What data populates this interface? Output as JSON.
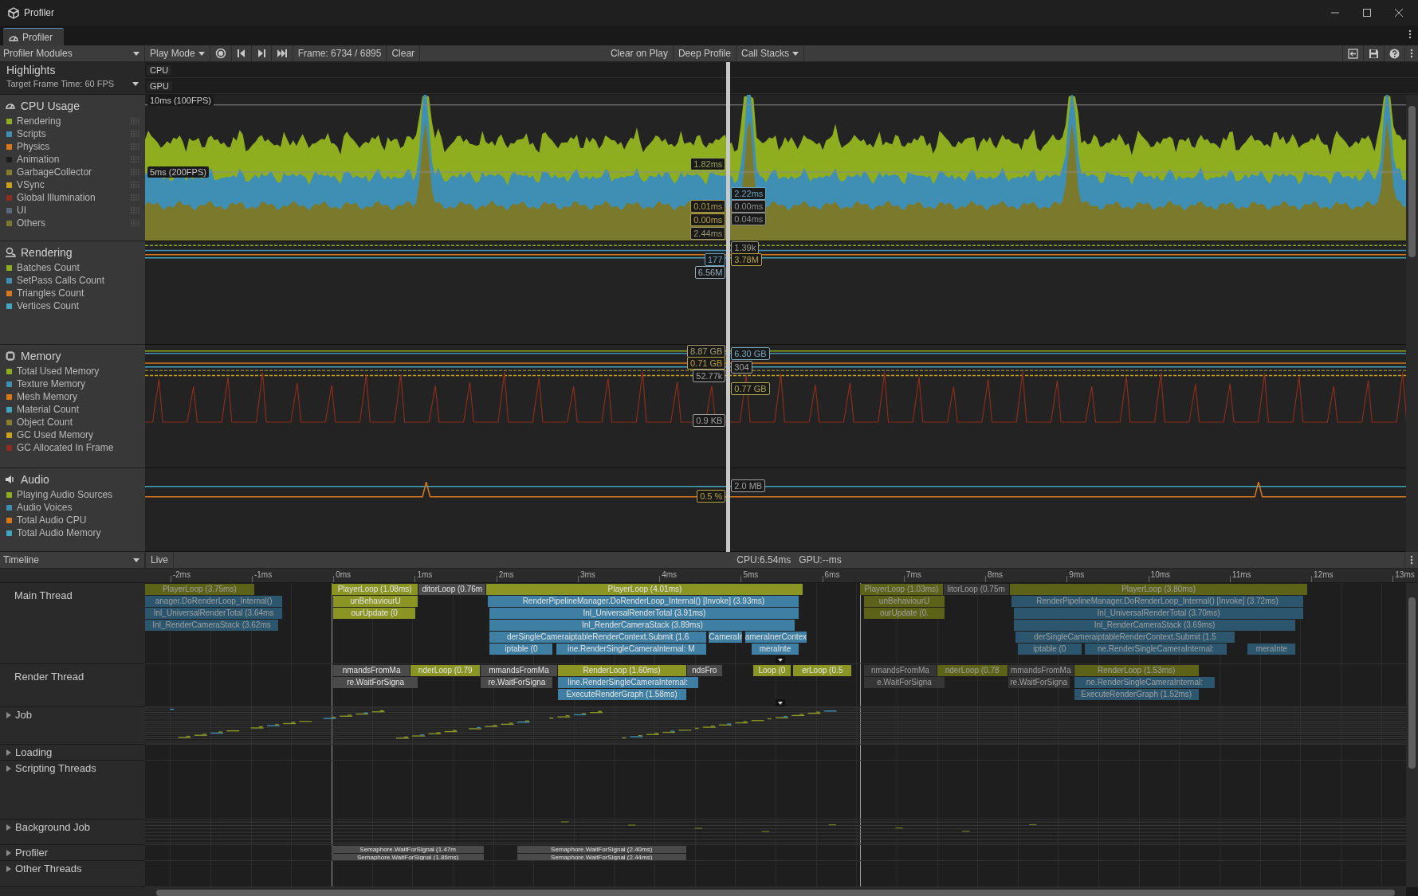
{
  "window": {
    "title": "Profiler"
  },
  "tabs": [
    {
      "label": "Profiler",
      "selected": true
    }
  ],
  "toolbar": {
    "modules_dropdown": "Profiler Modules",
    "play_mode": "Play Mode",
    "record": {
      "on": false
    },
    "frame": "Frame: 6734 / 6895",
    "clear": "Clear",
    "toggles": [
      {
        "label": "Clear on Play",
        "on": false
      },
      {
        "label": "Deep Profile",
        "on": false
      }
    ],
    "call_stacks": "Call Stacks"
  },
  "highlights": {
    "title": "Highlights",
    "target": "Target Frame Time: 60 FPS",
    "lanes": [
      "CPU",
      "GPU"
    ]
  },
  "modules": [
    {
      "name": "CPU Usage",
      "kind": "cpu",
      "grid_labels": [
        "10ms (100FPS)",
        "5ms (200FPS)"
      ],
      "legend": [
        {
          "label": "Rendering",
          "color": "#8fae1f"
        },
        {
          "label": "Scripts",
          "color": "#3f8fb5"
        },
        {
          "label": "Physics",
          "color": "#d7781c"
        },
        {
          "label": "Animation",
          "color": "#1b1b1b"
        },
        {
          "label": "GarbageCollector",
          "color": "#857c2c"
        },
        {
          "label": "VSync",
          "color": "#c9a11a"
        },
        {
          "label": "Global Illumination",
          "color": "#8c2d1d"
        },
        {
          "label": "UI",
          "color": "#586878"
        },
        {
          "label": "Others",
          "color": "#7b7a2c"
        }
      ],
      "readouts": [
        {
          "text": "1.82ms",
          "color": "#9aa84a"
        },
        {
          "text": "0.01ms",
          "color": "#a89a4a"
        },
        {
          "text": "0.00ms",
          "color": "#b8a040"
        },
        {
          "text": "2.44ms",
          "color": "#9a9670"
        },
        {
          "text": "2.22ms",
          "color": "#6aa3c0"
        },
        {
          "text": "0.00ms",
          "color": "#8e8e8e"
        },
        {
          "text": "0.04ms",
          "color": "#8e8e8e"
        }
      ]
    },
    {
      "name": "Rendering",
      "kind": "rendering",
      "legend": [
        {
          "label": "Batches Count",
          "color": "#8fae1f"
        },
        {
          "label": "SetPass Calls Count",
          "color": "#3f8fb5"
        },
        {
          "label": "Triangles Count",
          "color": "#d7781c"
        },
        {
          "label": "Vertices Count",
          "color": "#43a6c0"
        }
      ],
      "readouts": [
        {
          "text": "1.39k",
          "color": "#9a9a8a"
        },
        {
          "text": "177",
          "color": "#6aa3c0"
        },
        {
          "text": "3.78M",
          "color": "#b8a040"
        },
        {
          "text": "6.56M",
          "color": "#9ab0c0"
        }
      ]
    },
    {
      "name": "Memory",
      "kind": "memory",
      "legend": [
        {
          "label": "Total Used Memory",
          "color": "#8fae1f"
        },
        {
          "label": "Texture Memory",
          "color": "#3f8fb5"
        },
        {
          "label": "Mesh Memory",
          "color": "#d7781c"
        },
        {
          "label": "Material Count",
          "color": "#43a6c0"
        },
        {
          "label": "Object Count",
          "color": "#857c2c"
        },
        {
          "label": "GC Used Memory",
          "color": "#c9a11a"
        },
        {
          "label": "GC Allocated In Frame",
          "color": "#8c2d1d"
        }
      ],
      "readouts": [
        {
          "text": "8.87 GB",
          "color": "#a8a070"
        },
        {
          "text": "6.30 GB",
          "color": "#7aa8c0"
        },
        {
          "text": "0.71 GB",
          "color": "#b8a040"
        },
        {
          "text": "304",
          "color": "#a0a0a0"
        },
        {
          "text": "52.77k",
          "color": "#a0a0a0"
        },
        {
          "text": "0.77 GB",
          "color": "#b0a850"
        },
        {
          "text": "0.9 KB",
          "color": "#a0a0a0"
        }
      ]
    },
    {
      "name": "Audio",
      "kind": "audio",
      "legend": [
        {
          "label": "Playing Audio Sources",
          "color": "#8fae1f"
        },
        {
          "label": "Audio Voices",
          "color": "#3f8fb5"
        },
        {
          "label": "Total Audio CPU",
          "color": "#d7781c"
        },
        {
          "label": "Total Audio Memory",
          "color": "#43a6c0"
        }
      ],
      "readouts": [
        {
          "text": "2.0 MB",
          "color": "#a0a0a0"
        },
        {
          "text": "0.5 %",
          "color": "#b8a040"
        }
      ]
    }
  ],
  "timeline": {
    "view": "Timeline",
    "live": "Live",
    "cpu": "CPU:6.54ms",
    "gpu": "GPU:--ms",
    "ticks": [
      "-2ms",
      "-1ms",
      "0ms",
      "1ms",
      "2ms",
      "3ms",
      "4ms",
      "5ms",
      "6ms",
      "7ms",
      "8ms",
      "9ms",
      "10ms",
      "11ms",
      "12ms",
      "13ms"
    ],
    "threads": [
      {
        "name": "Main Thread",
        "blocks": [
          {
            "label": "PlayerLoop (3.75ms)",
            "color": "#5c6319",
            "dimmed": true
          },
          {
            "label": "PlayerLoop (1.08ms)",
            "color": "#8a9524",
            "dimmed": false
          },
          {
            "label": "ditorLoop (0.76m",
            "color": "#4a4a4a",
            "dimmed": false
          },
          {
            "label": "PlayerLoop (4.01ms)",
            "color": "#8a9524",
            "dimmed": false
          },
          {
            "label": "PlayerLoop (1.03ms)",
            "color": "#5c6319",
            "dimmed": true
          },
          {
            "label": "litorLoop (0.75m",
            "color": "#353535",
            "dimmed": true
          },
          {
            "label": "PlayerLoop (3.80ms)",
            "color": "#5c6319",
            "dimmed": true
          },
          {
            "label": "anager.DoRenderLoop_Internal()",
            "color": "#2b566e",
            "dimmed": true
          },
          {
            "label": "unBehaviourU",
            "color": "#8a9524",
            "dimmed": false
          },
          {
            "label": "RenderPipelineManager.DoRenderLoop_Internal() [Invoke] (3.93ms)",
            "color": "#3f7fa3",
            "dimmed": false
          },
          {
            "label": "unBehaviourU",
            "color": "#5c6319",
            "dimmed": true
          },
          {
            "label": "RenderPipelineManager.DoRenderLoop_Internal() [Invoke] (3.72ms)",
            "color": "#2b566e",
            "dimmed": true
          },
          {
            "label": "Inl_UniversalRenderTotal (3.64ms",
            "color": "#2b566e",
            "dimmed": true
          },
          {
            "label": "ourUpdate (0",
            "color": "#8a9524",
            "dimmed": false
          },
          {
            "label": "Inl_UniversalRenderTotal (3.91ms)",
            "color": "#3f7fa3",
            "dimmed": false
          },
          {
            "label": "ourUpdate (0.",
            "color": "#5c6319",
            "dimmed": true
          },
          {
            "label": "Inl_UniversalRenderTotal (3.70ms)",
            "color": "#2b566e",
            "dimmed": true
          },
          {
            "label": "Inl_RenderCameraStack (3.62ms",
            "color": "#2b566e",
            "dimmed": true
          },
          {
            "label": "Inl_RenderCameraStack (3.89ms)",
            "color": "#3f7fa3",
            "dimmed": false
          },
          {
            "label": "Inl_RenderCameraStack (3.69ms)",
            "color": "#2b566e",
            "dimmed": true
          },
          {
            "label": "derSingleCameraiptableRenderContext.Submit (1.6",
            "color": "#3f7fa3",
            "dimmed": false
          },
          {
            "label": "CameraIr",
            "color": "#3f7fa3",
            "dimmed": false
          },
          {
            "label": "ameraInerContex",
            "color": "#3f7fa3",
            "dimmed": false
          },
          {
            "label": "derSingleCameraiptableRenderContext.Submit (1.5",
            "color": "#2b566e",
            "dimmed": true
          },
          {
            "label": "iptable (0",
            "color": "#3f7fa3",
            "dimmed": false
          },
          {
            "label": "ine.RenderSingleCameraInternal: M",
            "color": "#3f7fa3",
            "dimmed": false
          },
          {
            "label": "meraInte",
            "color": "#3f7fa3",
            "dimmed": false
          },
          {
            "label": "iptable (0",
            "color": "#2b566e",
            "dimmed": true
          },
          {
            "label": "ne.RenderSingleCameraInternal:",
            "color": "#2b566e",
            "dimmed": true
          },
          {
            "label": "meraInte",
            "color": "#2b566e",
            "dimmed": true
          }
        ]
      },
      {
        "name": "Render Thread",
        "blocks": [
          {
            "label": "nmandsFromMa",
            "color": "#4a4a4a",
            "dimmed": false
          },
          {
            "label": "nderLoop (0.79",
            "color": "#8a9524",
            "dimmed": false
          },
          {
            "label": "mmandsFromMa",
            "color": "#4a4a4a",
            "dimmed": false
          },
          {
            "label": "RenderLoop (1.60ms)",
            "color": "#8a9524",
            "dimmed": false
          },
          {
            "label": "ndsFro",
            "color": "#4a4a4a",
            "dimmed": false
          },
          {
            "label": "Loop (0",
            "color": "#8a9524",
            "dimmed": false
          },
          {
            "label": "erLoop (0.5",
            "color": "#8a9524",
            "dimmed": false
          },
          {
            "label": "nmandsFromMa",
            "color": "#353535",
            "dimmed": true
          },
          {
            "label": "nderLoop (0.78",
            "color": "#5c6319",
            "dimmed": true
          },
          {
            "label": "mmandsFromMa",
            "color": "#353535",
            "dimmed": true
          },
          {
            "label": "RenderLoop (1.53ms)",
            "color": "#5c6319",
            "dimmed": true
          },
          {
            "label": "re.WaitForSigna",
            "color": "#4a4a4a",
            "dimmed": false
          },
          {
            "label": "re.WaitForSigna",
            "color": "#4a4a4a",
            "dimmed": false
          },
          {
            "label": "line.RenderSingleCameraInternal:",
            "color": "#3f7fa3",
            "dimmed": false
          },
          {
            "label": "e.WaitForSigna",
            "color": "#353535",
            "dimmed": true
          },
          {
            "label": "re.WaitForSigna",
            "color": "#353535",
            "dimmed": true
          },
          {
            "label": "ne.RenderSingleCameraInternal:",
            "color": "#2b566e",
            "dimmed": true
          },
          {
            "label": "ExecuteRenderGraph (1.58ms)",
            "color": "#3f7fa3",
            "dimmed": false
          },
          {
            "label": "ExecuteRenderGraph (1.52ms)",
            "color": "#2b566e",
            "dimmed": true
          }
        ]
      }
    ],
    "groups": [
      {
        "name": "Job",
        "expanded": false
      },
      {
        "name": "Loading",
        "expanded": false
      },
      {
        "name": "Scripting Threads",
        "expanded": false
      },
      {
        "name": "Background Job",
        "expanded": false
      },
      {
        "name": "Profiler",
        "expanded": false,
        "blocks": [
          {
            "label": "Semaphore.WaitForSignal (1.47m",
            "color": "#4a4a4a",
            "dimmed": false
          },
          {
            "label": "Semaphore.WaitForSignal (2.40ms)",
            "color": "#4a4a4a",
            "dimmed": false
          },
          {
            "label": "Semaphore.WaitForSignal (1.86ms)",
            "color": "#4a4a4a",
            "dimmed": false
          },
          {
            "label": "Semaphore.WaitForSignal (2.44ms)",
            "color": "#4a4a4a",
            "dimmed": false
          }
        ]
      },
      {
        "name": "Other Threads",
        "expanded": false
      }
    ]
  }
}
